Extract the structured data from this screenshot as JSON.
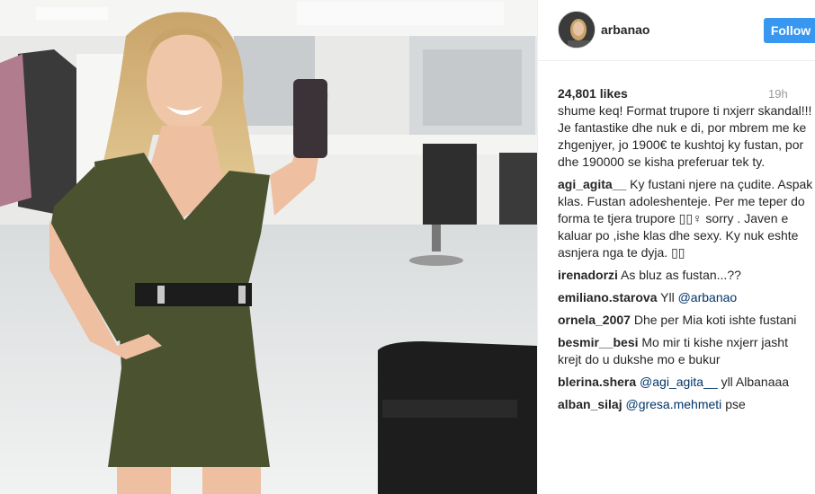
{
  "header": {
    "username": "arbanao",
    "follow_label": "Follow"
  },
  "stats": {
    "likes": "24,801 likes",
    "time": "19h"
  },
  "comments": [
    {
      "user": "",
      "text": "shume keq! Format trupore ti nxjerr skandal!!! Je fantastike dhe nuk e di, por mbrem me ke zhgenjyer, jo 1900€ te kushtoj ky fustan, por dhe 190000 se kisha preferuar tek ty."
    },
    {
      "user": "agi_agita__",
      "text": "Ky fustani njere na çudite. Aspak klas. Fustan adoleshenteje. Per me teper do forma te tjera trupore ▯▯♀ sorry . Javen e kaluar po ,ishe klas dhe sexy. Ky nuk eshte asnjera nga te dyja. ▯▯"
    },
    {
      "user": "irenadorzi",
      "text": "As bluz as fustan...??"
    },
    {
      "user": "emiliano.starova",
      "text": "Yll",
      "mention": "@arbanao"
    },
    {
      "user": "ornela_2007",
      "text": "Dhe per Mia koti ishte fustani"
    },
    {
      "user": "besmir__besi",
      "text": "Mo mir ti kishe nxjerr jasht krejt do u dukshe mo e bukur"
    },
    {
      "user": "blerina.shera",
      "mention": "@agi_agita__",
      "text": "yll Albanaaa"
    },
    {
      "user": "alban_silaj",
      "mention": "@gresa.mehmeti",
      "text": "pse"
    }
  ],
  "colors": {
    "accent": "#3897f0",
    "mention": "#003569",
    "dress": "#4a5230"
  },
  "icons": {
    "avatar": "profile-avatar"
  }
}
